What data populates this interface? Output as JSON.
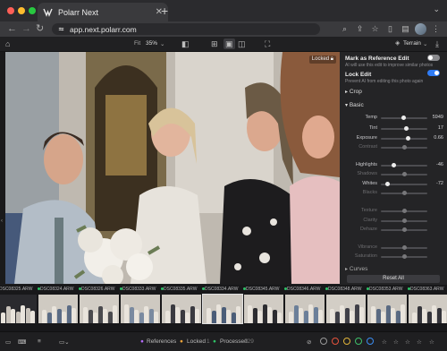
{
  "browser": {
    "tab_title": "Polarr Next",
    "url": "app.next.polarr.com",
    "colors": {
      "close": "#ff5f57",
      "minimize": "#febc2e",
      "maximize": "#28c840"
    }
  },
  "toolbar": {
    "fit_label": "Fit",
    "zoom": "35%",
    "compare_icon": "split-compare-icon",
    "terrain_label": "Terrain"
  },
  "photo": {
    "locked_label": "Locked"
  },
  "panel": {
    "reference_title": "Mark as Reference Edit",
    "reference_sub": "AI will use this edit to improve similar photos",
    "lock_title": "Lock Edit",
    "lock_sub": "Prevent AI from editing this photo again",
    "crop_label": "Crop",
    "basic_label": "Basic",
    "curves_label": "Curves",
    "reset_all": "Reset All",
    "sliders": [
      {
        "label": "Temp",
        "value": "5949",
        "pos": 0.48,
        "active": true
      },
      {
        "label": "Tint",
        "value": "17",
        "pos": 0.54,
        "active": true
      },
      {
        "label": "Exposure",
        "value": "0.66",
        "pos": 0.57,
        "active": true
      },
      {
        "label": "Contrast",
        "value": "0",
        "pos": 0.5,
        "active": false
      },
      {
        "label": "Highlights",
        "value": "-46",
        "pos": 0.27,
        "active": true
      },
      {
        "label": "Shadows",
        "value": "0",
        "pos": 0.5,
        "active": false
      },
      {
        "label": "Whites",
        "value": "-72",
        "pos": 0.14,
        "active": true
      },
      {
        "label": "Blacks",
        "value": "0",
        "pos": 0.5,
        "active": false
      },
      {
        "label": "Texture",
        "value": "0",
        "pos": 0.5,
        "active": false
      },
      {
        "label": "Clarity",
        "value": "0",
        "pos": 0.5,
        "active": false
      },
      {
        "label": "Dehaze",
        "value": "0",
        "pos": 0.5,
        "active": false
      },
      {
        "label": "Vibrance",
        "value": "0",
        "pos": 0.5,
        "active": false
      },
      {
        "label": "Saturation",
        "value": "0",
        "pos": 0.5,
        "active": false
      }
    ]
  },
  "filmstrip": {
    "items": [
      {
        "name": "DSC08325.ARW",
        "selected": false
      },
      {
        "name": "DSC08324.ARW",
        "selected": false
      },
      {
        "name": "DSC08326.ARW",
        "selected": false
      },
      {
        "name": "DSC08333.ARW",
        "selected": false
      },
      {
        "name": "DSC08335.ARW",
        "selected": false
      },
      {
        "name": "DSC08334.ARW",
        "selected": true
      },
      {
        "name": "DSC08345.ARW",
        "selected": false
      },
      {
        "name": "DSC08346.ARW",
        "selected": false
      },
      {
        "name": "DSC08348.ARW",
        "selected": false
      },
      {
        "name": "DSC08353.ARW",
        "selected": false
      },
      {
        "name": "DSC08363.ARW",
        "selected": false
      }
    ]
  },
  "status": {
    "references_label": "References",
    "locked_label": "Locked",
    "locked_count": "1",
    "processed_label": "Processed",
    "processed_count": "229"
  }
}
